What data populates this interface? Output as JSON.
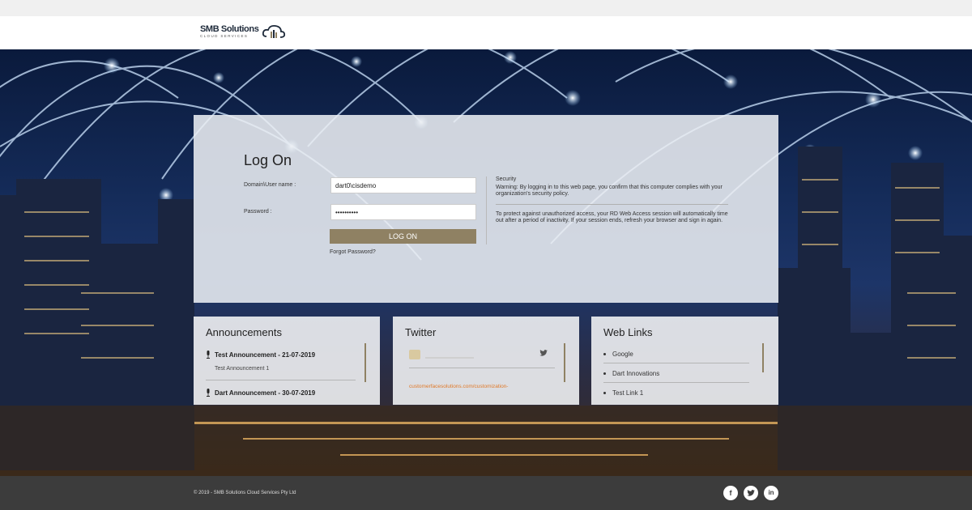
{
  "brand": {
    "name": "SMB Solutions",
    "sub": "CLOUD SERVICES"
  },
  "login": {
    "title": "Log On",
    "username_label": "Domain\\User name :",
    "username_value": "dart0\\cisdemo",
    "password_label": "Password :",
    "password_value": "••••••••••",
    "button_label": "LOG ON",
    "forgot_label": "Forgot Password?"
  },
  "security": {
    "heading": "Security",
    "warning": "Warning: By logging in to this web page, you confirm that this computer complies with your organization's security policy.",
    "timeout": "To protect against unauthorized access, your RD Web Access session will automatically time out after a period of inactivity. If your session ends, refresh your browser and sign in again."
  },
  "announcements": {
    "title": "Announcements",
    "items": [
      {
        "title": "Test Announcement - 21-07-2019",
        "body": "Test Announcement 1"
      },
      {
        "title": "Dart Announcement - 30-07-2019",
        "body": ""
      }
    ]
  },
  "twitter": {
    "title": "Twitter",
    "link": "customerfacesolutions.com/customization-"
  },
  "weblinks": {
    "title": "Web Links",
    "items": [
      "Google",
      "Dart Innovations",
      "Test Link 1"
    ]
  },
  "footer": {
    "copyright": "© 2019 - SMB Solutions Cloud Services Pty Ltd",
    "social": [
      "facebook-icon",
      "twitter-icon",
      "linkedin-icon"
    ]
  },
  "colors": {
    "accent": "#8f8163",
    "footer": "#3c3c3c",
    "link": "#e07a2a"
  }
}
